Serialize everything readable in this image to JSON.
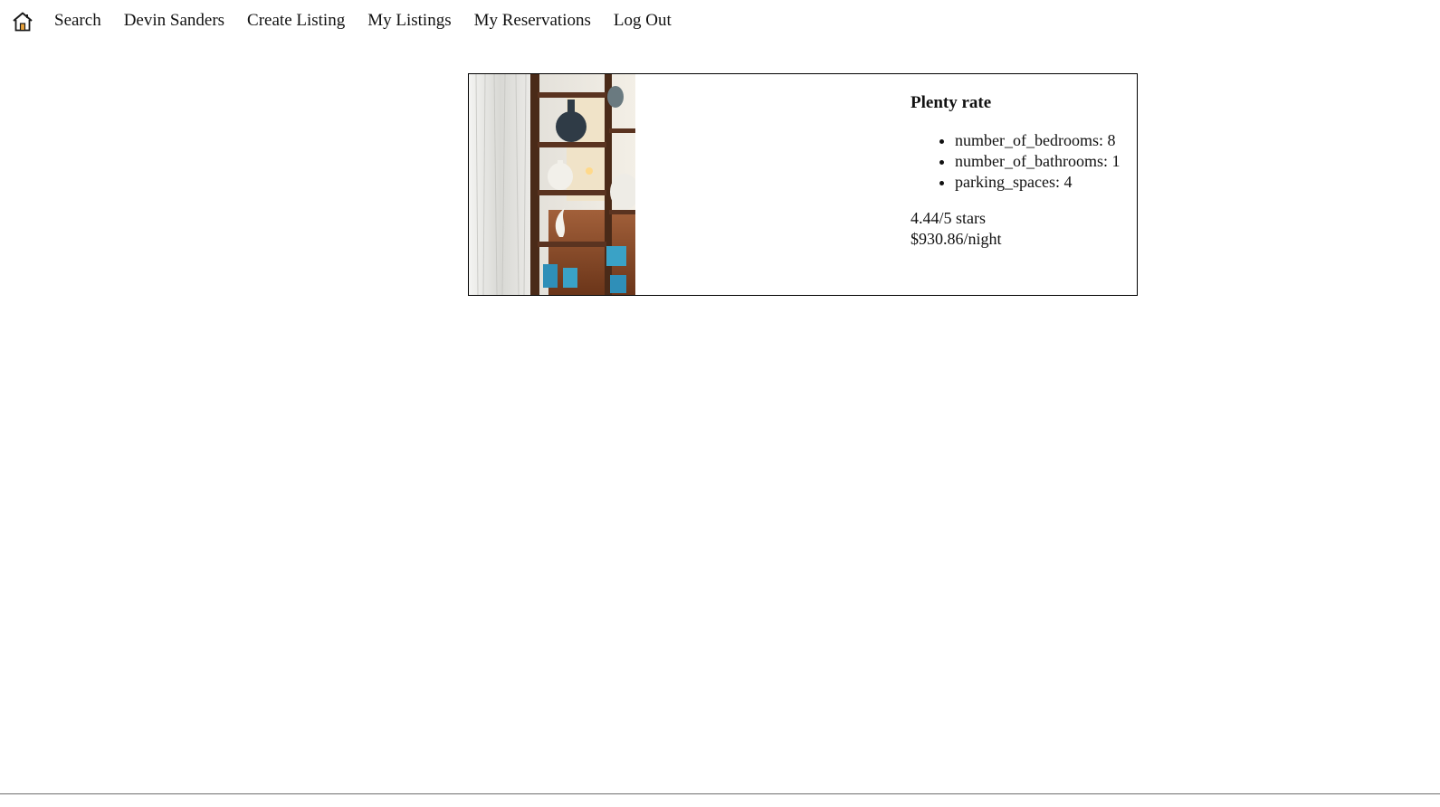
{
  "nav": {
    "home_icon": "home-icon",
    "links": {
      "search": "Search",
      "user": "Devin Sanders",
      "create_listing": "Create Listing",
      "my_listings": "My Listings",
      "my_reservations": "My Reservations",
      "log_out": "Log Out"
    }
  },
  "listing": {
    "title": "Plenty rate",
    "features": [
      "number_of_bedrooms: 8",
      "number_of_bathrooms: 1",
      "parking_spaces: 4"
    ],
    "rating": "4.44/5 stars",
    "price": "$930.86/night",
    "image_icon": "listing-photo"
  },
  "colors": {
    "home_icon_stroke": "#1a1a1a",
    "home_icon_fill": "#e9a23b",
    "card_border": "#000000"
  }
}
